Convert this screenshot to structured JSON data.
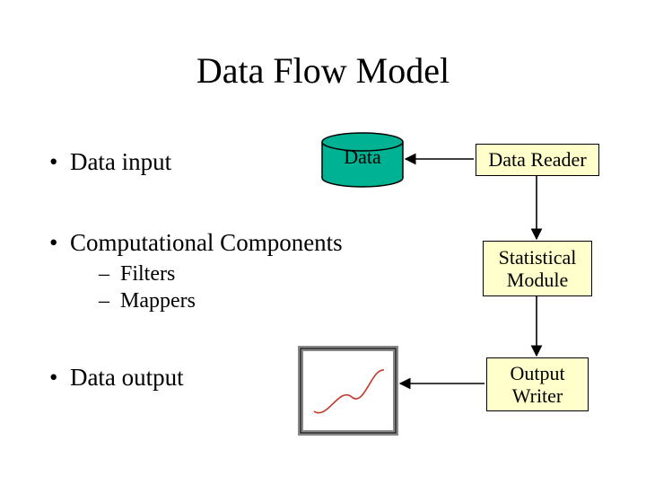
{
  "title": "Data Flow Model",
  "bullets": {
    "b1": "Data input",
    "b2": "Computational Components",
    "b2a": "Filters",
    "b2b": "Mappers",
    "b3": "Data output"
  },
  "nodes": {
    "data": "Data",
    "reader": "Data Reader",
    "stat": "Statistical Module",
    "writer": "Output Writer"
  },
  "colors": {
    "cylinder": "#00b294",
    "box_fill": "#ffffcc"
  }
}
